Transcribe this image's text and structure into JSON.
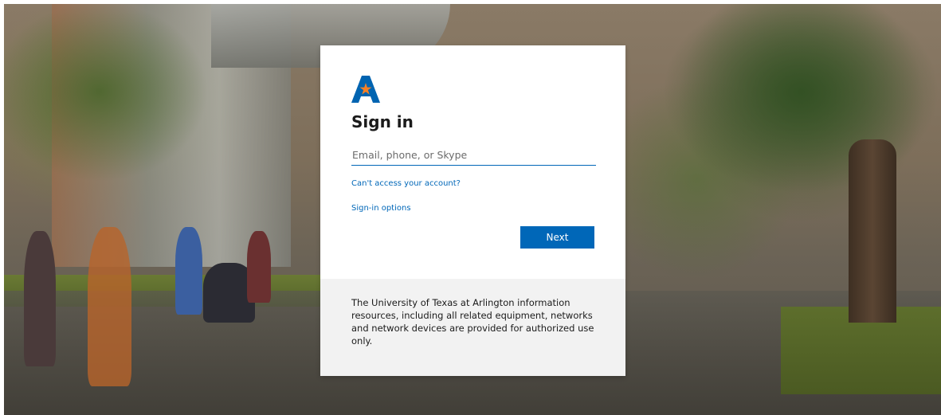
{
  "signin": {
    "title": "Sign in",
    "email_placeholder": "Email, phone, or Skype",
    "email_value": "",
    "cant_access_link": "Can't access your account?",
    "signin_options_link": "Sign-in options",
    "next_button": "Next"
  },
  "notice": {
    "text": "The University of Texas at Arlington information resources, including all related equipment, networks and network devices are provided for authorized use only."
  },
  "colors": {
    "accent": "#0067b8",
    "logo_blue": "#0064b1",
    "logo_star": "#f58025",
    "footer_bg": "#f2f2f2"
  },
  "icons": {
    "logo": "uta-a-star-logo"
  }
}
